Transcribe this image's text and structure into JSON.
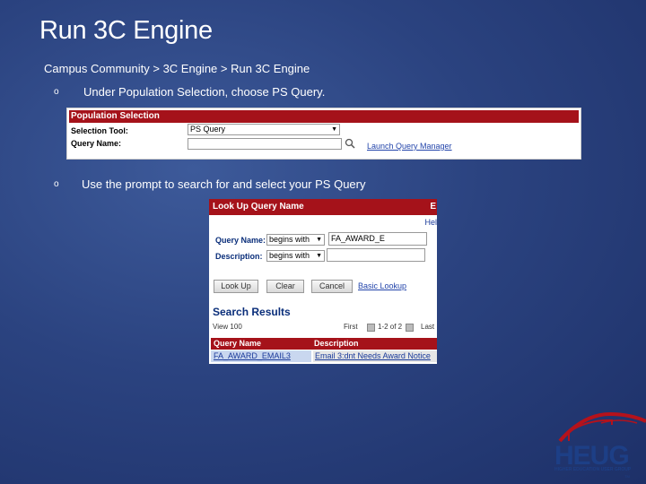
{
  "slide": {
    "title": "Run 3C Engine",
    "breadcrumb": "Campus Community > 3C Engine > Run 3C Engine",
    "bullet1": "Under Population Selection, choose PS Query.",
    "bullet2": "Use the prompt to search for and select your PS Query",
    "bullet_mark": "o"
  },
  "population_selection": {
    "header": "Population Selection",
    "selection_tool_label": "Selection Tool:",
    "selection_tool_value": "PS Query",
    "query_name_label": "Query Name:",
    "query_name_value": "",
    "launch_link": "Launch Query Manager"
  },
  "lookup": {
    "header": "Look Up Query Name",
    "header_cut": "E",
    "help": "Hel",
    "query_name_label": "Query Name:",
    "query_name_operator": "begins with",
    "query_name_value": "FA_AWARD_E",
    "description_label": "Description:",
    "description_operator": "begins with",
    "description_value": "",
    "buttons": {
      "lookup": "Look Up",
      "clear": "Clear",
      "cancel": "Cancel",
      "basic_lookup": "Basic Lookup"
    },
    "results_title": "Search Results",
    "view_100": "View 100",
    "first": "First",
    "count": "1-2 of 2",
    "last": "Last",
    "columns": [
      "Query Name",
      "Description"
    ],
    "rows": [
      [
        "FA_AWARD_EMAIL3",
        "Email 3:dnt Needs Award Notice"
      ]
    ]
  },
  "logo": {
    "name": "HEUG",
    "subtitle": "HIGHER EDUCATION USER GROUP",
    "tm": "TM"
  },
  "colors": {
    "header_red": "#a5121a",
    "link_blue": "#2244aa",
    "background": "#2b4380"
  }
}
